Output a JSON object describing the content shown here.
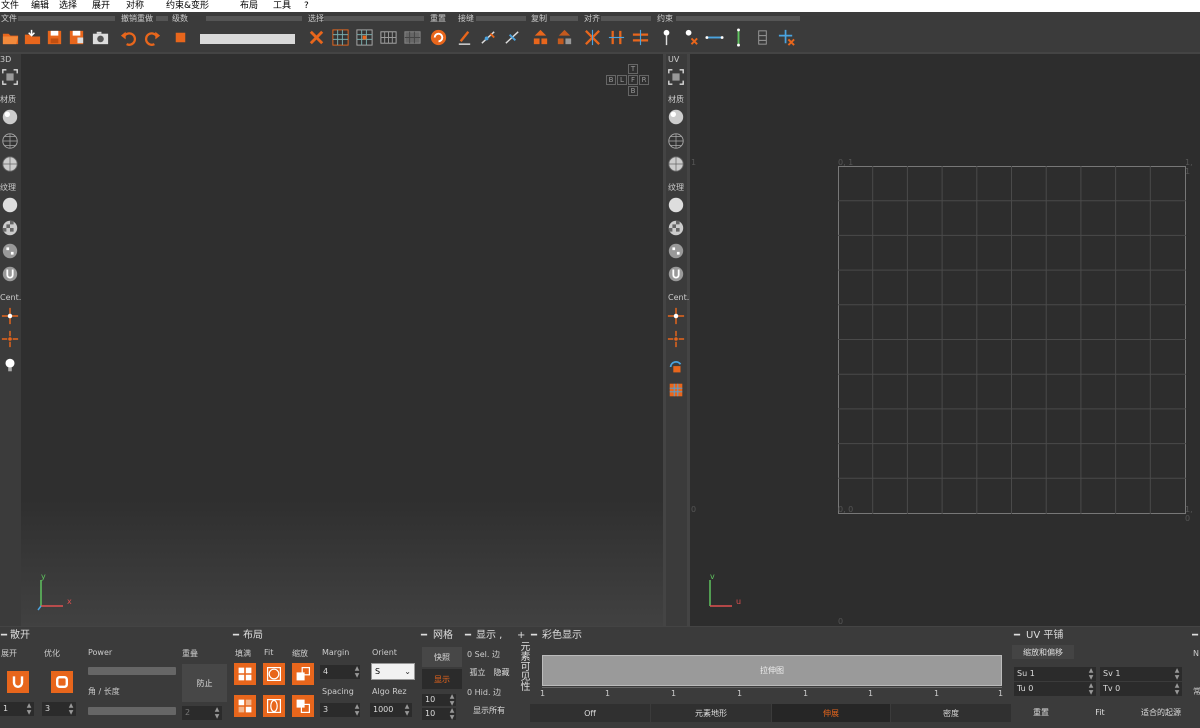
{
  "menu": [
    "文件",
    "编辑",
    "选择",
    "展开",
    "对称",
    "约束&变形",
    "布局",
    "工具",
    "?"
  ],
  "toolbar_groups": {
    "file": "文件",
    "undo_redo": "撤销重做",
    "levels": "级数",
    "select": "选择",
    "reset": "重置",
    "seams": "接缝",
    "copy": "复制",
    "align": "对齐",
    "constraints": "约束"
  },
  "sidebar_left": {
    "view": "3D",
    "material": "材质",
    "texture": "纹理",
    "center": "Cent."
  },
  "sidebar_right": {
    "view": "UV",
    "material": "材质",
    "texture": "纹理",
    "center": "Cent."
  },
  "viewport_3d": {
    "cube_faces": {
      "top": "T",
      "back": "B",
      "left": "L",
      "front": "F",
      "right": "R",
      "bottom": "B"
    },
    "axes": {
      "x": "x",
      "y": "y"
    }
  },
  "viewport_uv": {
    "corners": {
      "top_left": "0, 1",
      "top_right": "1, 1",
      "bottom_left": "0, 0",
      "bottom_right": "1, 0"
    },
    "ticks": {
      "left_top": "1",
      "left_bottom": "0",
      "bottom": "0"
    },
    "axes": {
      "u": "u",
      "v": "v"
    }
  },
  "panel_unfold": {
    "title": "散开",
    "unfold_label": "展开",
    "optimize_label": "优化",
    "power_label": "Power",
    "angle_length_label": "角   / 长度",
    "overlap_label": "重叠",
    "prevent_label": "防止",
    "unfold_value": "1",
    "optimize_value": "3",
    "overlap_value": "2"
  },
  "panel_layout": {
    "title": "布局",
    "fill_label": "填满",
    "fit_label": "Fit",
    "scale_label": "缩放",
    "margin_label": "Margin",
    "margin_value": "4",
    "spacing_label": "Spacing",
    "spacing_value": "3",
    "orient_label": "Orient",
    "orient_value": "S",
    "algo_label": "Algo Rez",
    "algo_value": "1000"
  },
  "panel_grid": {
    "title": "网格",
    "snap_label": "快照",
    "show_label": "显示",
    "value_1": "10",
    "value_2": "10"
  },
  "panel_display": {
    "title": "显示 ,",
    "sel_edges": "0 Sel. 边",
    "isolate": "孤立",
    "hide": "隐藏",
    "hid_edges": "0 Hid. 边",
    "show_all": "显示所有"
  },
  "panel_visibility": {
    "title": "元素可见性"
  },
  "panel_color": {
    "title": "彩色显示",
    "gradient_label": "拉伸图",
    "scale_ticks": [
      "1",
      "1",
      "1",
      "1",
      "1",
      "1",
      "1",
      "1"
    ],
    "modes": [
      "Off",
      "元素地形",
      "伸展",
      "密度"
    ]
  },
  "panel_uvtile": {
    "title": "UV 平铺",
    "tab_label": "缩放和偏移",
    "su_label": "Su 1",
    "sv_label": "Sv 1",
    "tu_label": "Tu 0",
    "tv_label": "Tv 0",
    "reset_label": "重置",
    "fit_label": "Fit",
    "fit_origin_label": "适合的起源"
  },
  "panel_extra": {
    "n_label": "N",
    "often_label": "常"
  },
  "colors": {
    "accent": "#e8661c",
    "background": "#2f2f2f",
    "panel": "#3b3b3b"
  }
}
